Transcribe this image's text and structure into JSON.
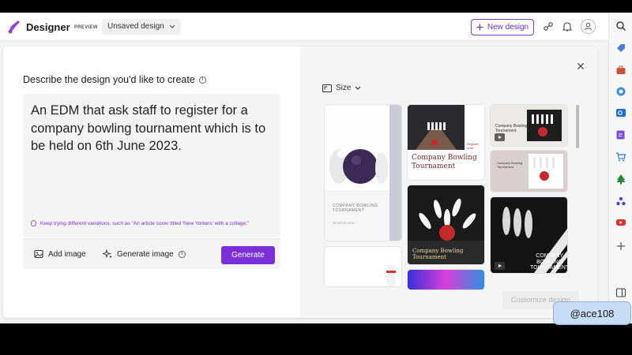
{
  "app": {
    "brand": "Designer",
    "badge": "PREVIEW",
    "doc_name": "Unsaved design",
    "new_design_label": "New design"
  },
  "prompt": {
    "title": "Describe the design you'd like to create",
    "text": "An EDM that ask staff to register for a company bowling tournament which is to be held on 6th June 2023.",
    "tip": "Keep trying different variations, such as \"An article cover titled 'New Yorkers' with a collage.\""
  },
  "toolbar": {
    "add_image_label": "Add image",
    "generate_image_label": "Generate image",
    "generate_label": "Generate"
  },
  "gallery": {
    "size_label": "Size",
    "customize_label": "Customize design",
    "thumbnails": [
      {
        "title": "COMPANY BOWLING\nTOURNAMENT",
        "subtitle": "REGISTER NOW"
      },
      {
        "title": "Company Bowling\nTournament",
        "tag": "Register\nnow!"
      },
      {
        "title": "Company Bowling\nTournament"
      },
      {
        "title": "Company Bowling\nTournament"
      },
      {
        "title": "Company Bowling Tournament"
      },
      {
        "title": "COMPANY\nBOWLING\nTOURNAMENT"
      }
    ]
  },
  "overlay_handle": "@ace108",
  "colors": {
    "accent": "#7a2fd9",
    "background": "#f3f3f3"
  },
  "icons": [
    "designer-logo",
    "chevron-down-icon",
    "plus-icon",
    "share-icon",
    "notification-icon",
    "user-icon",
    "close-icon",
    "image-icon",
    "sparkle-icon",
    "info-icon",
    "bulb-icon",
    "resize-icon",
    "play-icon",
    "search-icon",
    "tag-icon",
    "briefcase-icon",
    "copilot-icon",
    "outlook-icon",
    "edit-icon",
    "cart-icon",
    "tree-icon",
    "games-icon",
    "youtube-icon",
    "add-icon",
    "sidebar-icon"
  ]
}
